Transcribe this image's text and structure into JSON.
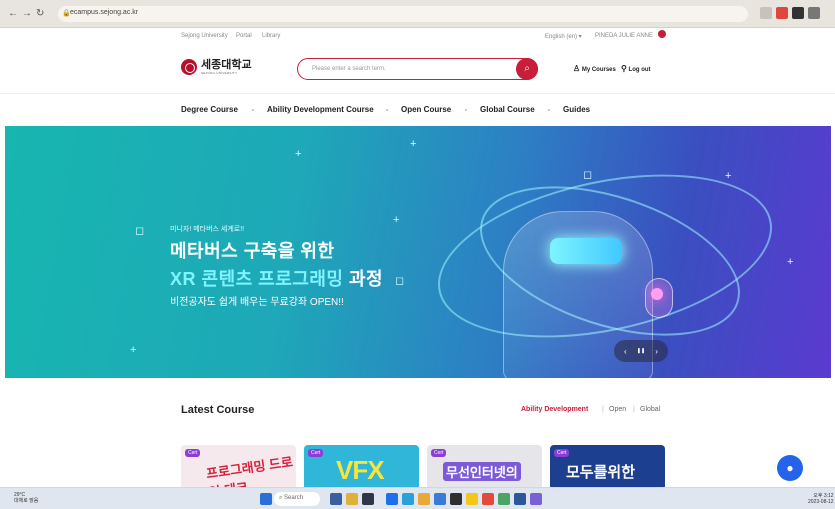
{
  "browser": {
    "url": "ecampus.sejong.ac.kr"
  },
  "utility_links": {
    "sejong_university": "Sejong University",
    "portal": "Portal",
    "library": "Library",
    "language": "English (en) ▾",
    "user_name": "PINEDA JULIE ANNE"
  },
  "header": {
    "logo_korean": "세종대학교",
    "logo_english": "SEJONG UNIVERSITY",
    "search_placeholder": "Please enter a search term.",
    "my_courses": "My Courses",
    "log_out": "Log out"
  },
  "menu": {
    "items": [
      "Degree Course",
      "Ability Development Course",
      "Open Course",
      "Global Course",
      "Guides"
    ]
  },
  "banner": {
    "tagline": "미니자! 메타버스 세계로!!",
    "headline_1": "메타버스 구축을 위한",
    "headline_2_accent": "XR 콘텐츠 프로그래밍",
    "headline_2_rest": " 과정",
    "headline_3": "비전공자도 쉽게 배우는 무료강좌 OPEN!!",
    "slider_prev": "‹",
    "slider_pause": "❚❚",
    "slider_next": "›"
  },
  "latest": {
    "title": "Latest Course",
    "filters": [
      "Ability Development",
      "Open",
      "Global"
    ]
  },
  "cards": [
    {
      "badge": "Cert",
      "title": "프로그래밍 드로잉 테크"
    },
    {
      "badge": "Cert",
      "title": "VFX"
    },
    {
      "badge": "Cert",
      "title": "무선인터넷의"
    },
    {
      "badge": "Cert",
      "title": "모두를위한"
    }
  ],
  "taskbar": {
    "weather_temp": "29°C",
    "weather_desc": "대체로 맑음",
    "search_label": "Search",
    "time": "오후 3:12",
    "date": "2023-08-12"
  },
  "colors": {
    "brand_red": "#c81e3a",
    "banner_start": "#17b6b0",
    "banner_end": "#5b3ad0",
    "chat_blue": "#2563eb"
  }
}
